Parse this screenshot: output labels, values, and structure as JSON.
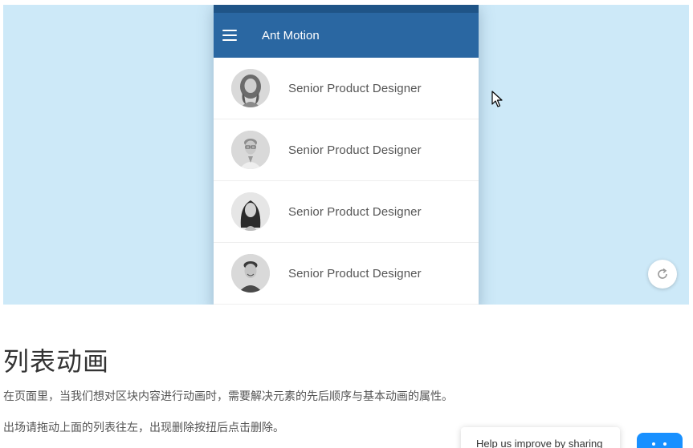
{
  "demo": {
    "app_title": "Ant Motion",
    "list_items": [
      {
        "title": "Senior Product Designer",
        "avatar": "woman-curly-hair"
      },
      {
        "title": "Senior Product Designer",
        "avatar": "man-glasses"
      },
      {
        "title": "Senior Product Designer",
        "avatar": "woman-long-dark-hair"
      },
      {
        "title": "Senior Product Designer",
        "avatar": "man-smiling"
      }
    ]
  },
  "article": {
    "title": "列表动画",
    "paragraph_1": "在页面里，当我们想对区块内容进行动画时，需要解决元素的先后顺序与基本动画的属性。",
    "paragraph_2": "出场请拖动上面的列表往左，出现删除按扭后点击删除。"
  },
  "feedback": {
    "label": "Help us improve by sharing"
  },
  "colors": {
    "demo_background": "#cde9f8",
    "header": "#2a67a2",
    "statusbar": "#1f5487",
    "feedback_button": "#1890ff"
  }
}
